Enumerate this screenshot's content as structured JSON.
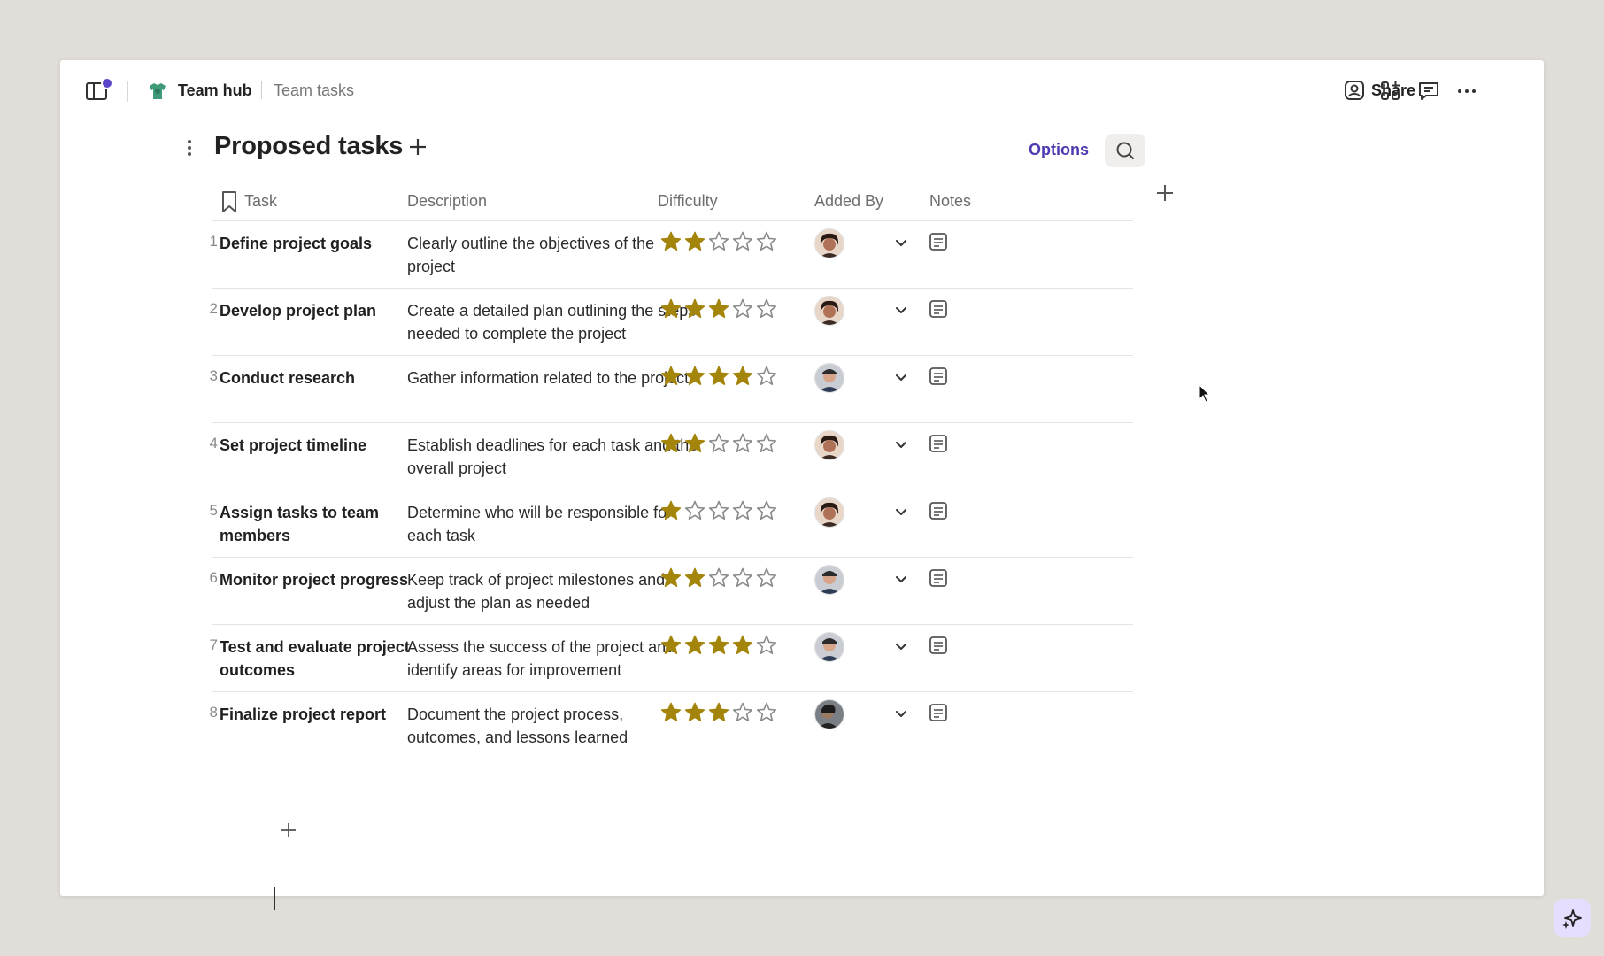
{
  "breadcrumb": {
    "hub": "Team hub",
    "page": "Team tasks"
  },
  "header": {
    "share_label": "Share"
  },
  "page": {
    "title": "Proposed tasks",
    "options_label": "Options"
  },
  "table": {
    "columns": [
      "Task",
      "Description",
      "Difficulty",
      "Added By",
      "Notes"
    ],
    "rows": [
      {
        "num": "1",
        "task": "Define project goals",
        "description": "Clearly outline the objectives of the project",
        "difficulty": 2,
        "avatar": "a"
      },
      {
        "num": "2",
        "task": "Develop project plan",
        "description": "Create a detailed plan outlining the steps needed to complete the project",
        "difficulty": 3,
        "avatar": "a"
      },
      {
        "num": "3",
        "task": "Conduct research",
        "description": "Gather information related to the project",
        "difficulty": 4,
        "avatar": "b"
      },
      {
        "num": "4",
        "task": "Set project timeline",
        "description": "Establish deadlines for each task and the overall project",
        "difficulty": 2,
        "avatar": "a"
      },
      {
        "num": "5",
        "task": "Assign tasks to team members",
        "description": "Determine who will be responsible for each task",
        "difficulty": 1,
        "avatar": "a"
      },
      {
        "num": "6",
        "task": "Monitor project progress",
        "description": "Keep track of project milestones and adjust the plan as needed",
        "difficulty": 2,
        "avatar": "b"
      },
      {
        "num": "7",
        "task": "Test and evaluate project outcomes",
        "description": "Assess the success of the project and identify areas for improvement",
        "difficulty": 4,
        "avatar": "b"
      },
      {
        "num": "8",
        "task": "Finalize project report",
        "description": "Document the project process, outcomes, and lessons learned",
        "difficulty": 3,
        "avatar": "c"
      }
    ]
  },
  "colors": {
    "accent": "#4b3ab0",
    "star_filled": "#a4850b",
    "star_empty": "#8a8a8a",
    "notification": "#5b46c9"
  },
  "icons": [
    "sidebar-toggle-icon",
    "team-hub-icon",
    "share-person-icon",
    "add-apps-icon",
    "comment-icon",
    "more-icon",
    "bookmark-icon",
    "search-icon",
    "plus-icon",
    "chevron-down-icon",
    "note-icon",
    "sparkle-icon"
  ]
}
